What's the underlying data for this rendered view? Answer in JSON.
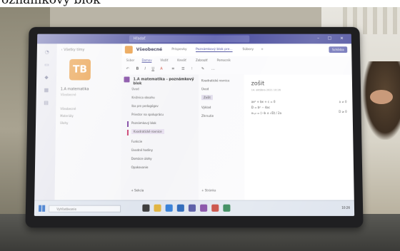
{
  "caption": "oznámkový blok",
  "window": {
    "search_placeholder": "Hľadať",
    "controls": "– ☐ ✕"
  },
  "teams_nav": {
    "back_link": "‹ Všetky tímy",
    "team_initials": "TB",
    "team_name": "1.A matematika",
    "team_sub": "Všeobecné",
    "channels": [
      "Všeobecné",
      "Materiály",
      "Úlohy"
    ]
  },
  "channel_header": {
    "title": "Všeobecné",
    "tabs": [
      "Príspevky",
      "Poznámkový blok pre...",
      "Súbory",
      "+"
    ],
    "active_tab": 1,
    "meet_label": "Schôdza"
  },
  "ribbon": {
    "tabs": [
      "Súbor",
      "Domov",
      "Vložiť",
      "Kresliť",
      "Zobraziť",
      "Pomocník"
    ],
    "active_tab": 1,
    "tools": [
      "↶",
      "B",
      "I",
      "U",
      "A",
      "≡",
      "☰",
      "⁝",
      "✎",
      "…"
    ]
  },
  "notebook": {
    "title": "1.A matematika - poznámkový blok",
    "sections": [
      "Úvod",
      "Knižnica obsahu",
      "Iba pre pedagógov",
      "Priestor na spoluprácu",
      "Poznámkový blok",
      "Kvadratické rovnice",
      "Funkcie",
      "Úvodné hodiny",
      "Domáce úlohy",
      "Opakovanie"
    ],
    "selected_section": 5,
    "add_section": "+ Sekcia"
  },
  "pages": {
    "items": [
      "Kvadratické rovnice",
      "Úvod",
      "Zošit",
      "Výklad",
      "Zhrnutie"
    ],
    "selected": 2,
    "add_page": "+ Stránka"
  },
  "canvas": {
    "heading": "zošit",
    "date": "14. októbra 2021 10:26",
    "notes": [
      "ax² + bx + c = 0",
      "D = b² − 4ac",
      "x₁,₂ = (−b ± √D) / 2a"
    ],
    "side_notes": [
      "a ≠ 0",
      "D ≥ 0"
    ]
  },
  "taskbar": {
    "search_placeholder": "Vyhľadávanie",
    "time": "10:26"
  },
  "colors": {
    "teams_purple": "#4b4e9e",
    "onenote_purple": "#7b3f9e",
    "team_orange": "#e8973a"
  }
}
